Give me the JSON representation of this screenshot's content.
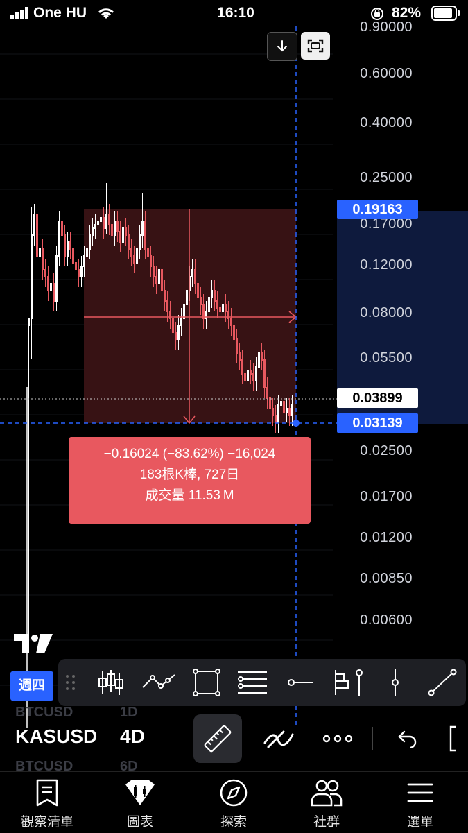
{
  "status_bar": {
    "carrier": "One HU",
    "time": "16:10",
    "battery_percent": "82%"
  },
  "chart": {
    "price_axis": [
      "0.90000",
      "0.60000",
      "0.40000",
      "0.25000",
      "0.17000",
      "0.12000",
      "0.08000",
      "0.05500",
      "0.02500",
      "0.01700",
      "0.01200",
      "0.00850",
      "0.00600"
    ],
    "high_price_tag": "0.19163",
    "last_price_tag": "0.03899",
    "cursor_price_tag": "0.03139",
    "measure": {
      "change_line": "−0.16024 (−83.62%) −16,024",
      "bars_line": "183根K棒, 727日",
      "volume_line": "成交量 11.53 M"
    },
    "colors": {
      "candle_up": "#ffffff",
      "candle_down": "#e8585f",
      "measure_fill": "#e8585f",
      "accent": "#2962ff"
    }
  },
  "day_badge": "週四",
  "toolbar": {
    "tools": [
      "candles-icon",
      "pattern-icon",
      "rectangle-icon",
      "fib-icon",
      "horizontal-line-icon",
      "long-position-icon",
      "vertical-ray-icon",
      "vertical-line-icon",
      "trend-line-icon"
    ]
  },
  "symbols": {
    "previous_symbol": "BTCUSD",
    "previous_tf": "1D",
    "current_symbol": "KASUSD",
    "current_tf": "4D",
    "next_symbol": "BTCUSD",
    "next_tf": "6D"
  },
  "bottom_nav": {
    "watchlist": "觀察清單",
    "chart": "圖表",
    "explore": "探索",
    "community": "社群",
    "menu": "選單"
  }
}
